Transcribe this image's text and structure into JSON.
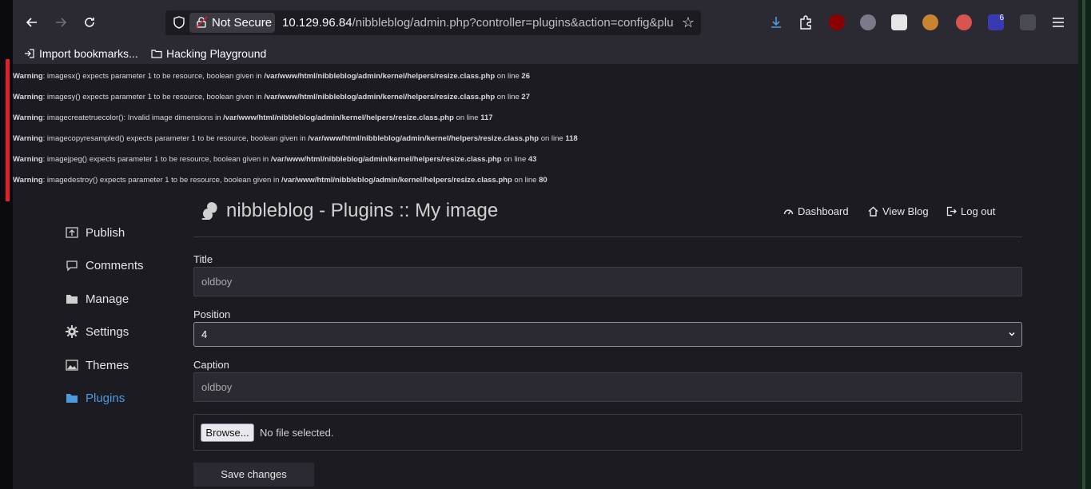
{
  "browser": {
    "not_secure": "Not Secure",
    "url_host": "10.129.96.84",
    "url_path": "/nibbleblog/admin.php?controller=plugins&action=config&plu",
    "ext_badge": "6"
  },
  "bookmarks": [
    {
      "label": "Import bookmarks..."
    },
    {
      "label": "Hacking Playground"
    }
  ],
  "warnings": [
    {
      "label": "Warning",
      "msg": ": imagesx() expects parameter 1 to be resource, boolean given in ",
      "file": "/var/www/html/nibbleblog/admin/kernel/helpers/resize.class.php",
      "on": " on line ",
      "line": "26"
    },
    {
      "label": "Warning",
      "msg": ": imagesy() expects parameter 1 to be resource, boolean given in ",
      "file": "/var/www/html/nibbleblog/admin/kernel/helpers/resize.class.php",
      "on": " on line ",
      "line": "27"
    },
    {
      "label": "Warning",
      "msg": ": imagecreatetruecolor(): Invalid image dimensions in ",
      "file": "/var/www/html/nibbleblog/admin/kernel/helpers/resize.class.php",
      "on": " on line ",
      "line": "117"
    },
    {
      "label": "Warning",
      "msg": ": imagecopyresampled() expects parameter 1 to be resource, boolean given in ",
      "file": "/var/www/html/nibbleblog/admin/kernel/helpers/resize.class.php",
      "on": " on line ",
      "line": "118"
    },
    {
      "label": "Warning",
      "msg": ": imagejpeg() expects parameter 1 to be resource, boolean given in ",
      "file": "/var/www/html/nibbleblog/admin/kernel/helpers/resize.class.php",
      "on": " on line ",
      "line": "43"
    },
    {
      "label": "Warning",
      "msg": ": imagedestroy() expects parameter 1 to be resource, boolean given in ",
      "file": "/var/www/html/nibbleblog/admin/kernel/helpers/resize.class.php",
      "on": " on line ",
      "line": "80"
    }
  ],
  "sidebar": {
    "items": [
      {
        "label": "Publish"
      },
      {
        "label": "Comments"
      },
      {
        "label": "Manage"
      },
      {
        "label": "Settings"
      },
      {
        "label": "Themes"
      },
      {
        "label": "Plugins"
      }
    ],
    "active_color": "#4a9be0"
  },
  "header": {
    "title": "nibbleblog - Plugins :: My image",
    "dashboard": "Dashboard",
    "view_blog": "View Blog",
    "logout": "Log out"
  },
  "form": {
    "title_label": "Title",
    "title_value": "oldboy",
    "position_label": "Position",
    "position_value": "4",
    "caption_label": "Caption",
    "caption_value": "oldboy",
    "browse_label": "Browse...",
    "no_file": "No file selected.",
    "save_label": "Save changes"
  }
}
